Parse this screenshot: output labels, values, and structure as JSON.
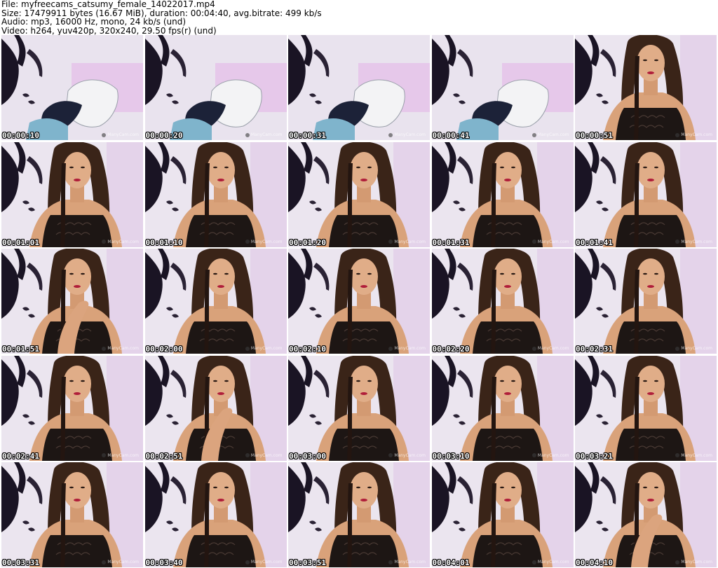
{
  "header": {
    "file_line": "File: myfreecams_catsumy_female_14022017.mp4",
    "size_line": "Size: 17479911 bytes (16.67 MiB), duration: 00:04:40, avg.bitrate: 499 kb/s",
    "audio_line": "Audio: mp3, 16000 Hz, mono, 24 kb/s (und)",
    "video_line": "Video: h264, yuv420p, 320x240, 29.50 fps(r) (und)"
  },
  "watermark": "ManyCam.com",
  "thumbnails": [
    {
      "timestamp": "00:00:10",
      "scene": "hat"
    },
    {
      "timestamp": "00:00:20",
      "scene": "hat"
    },
    {
      "timestamp": "00:00:31",
      "scene": "hat"
    },
    {
      "timestamp": "00:00:41",
      "scene": "hat"
    },
    {
      "timestamp": "00:00:51",
      "scene": "person"
    },
    {
      "timestamp": "00:01:01",
      "scene": "person"
    },
    {
      "timestamp": "00:01:10",
      "scene": "person"
    },
    {
      "timestamp": "00:01:20",
      "scene": "person"
    },
    {
      "timestamp": "00:01:31",
      "scene": "person"
    },
    {
      "timestamp": "00:01:41",
      "scene": "person"
    },
    {
      "timestamp": "00:01:51",
      "scene": "person-hand"
    },
    {
      "timestamp": "00:02:00",
      "scene": "person"
    },
    {
      "timestamp": "00:02:10",
      "scene": "person"
    },
    {
      "timestamp": "00:02:20",
      "scene": "person"
    },
    {
      "timestamp": "00:02:31",
      "scene": "person"
    },
    {
      "timestamp": "00:02:41",
      "scene": "person"
    },
    {
      "timestamp": "00:02:51",
      "scene": "person-hand"
    },
    {
      "timestamp": "00:03:00",
      "scene": "person"
    },
    {
      "timestamp": "00:03:10",
      "scene": "person"
    },
    {
      "timestamp": "00:03:21",
      "scene": "person"
    },
    {
      "timestamp": "00:03:31",
      "scene": "person"
    },
    {
      "timestamp": "00:03:40",
      "scene": "person"
    },
    {
      "timestamp": "00:03:51",
      "scene": "person"
    },
    {
      "timestamp": "00:04:01",
      "scene": "person"
    },
    {
      "timestamp": "00:04:10",
      "scene": "person-hand"
    }
  ]
}
